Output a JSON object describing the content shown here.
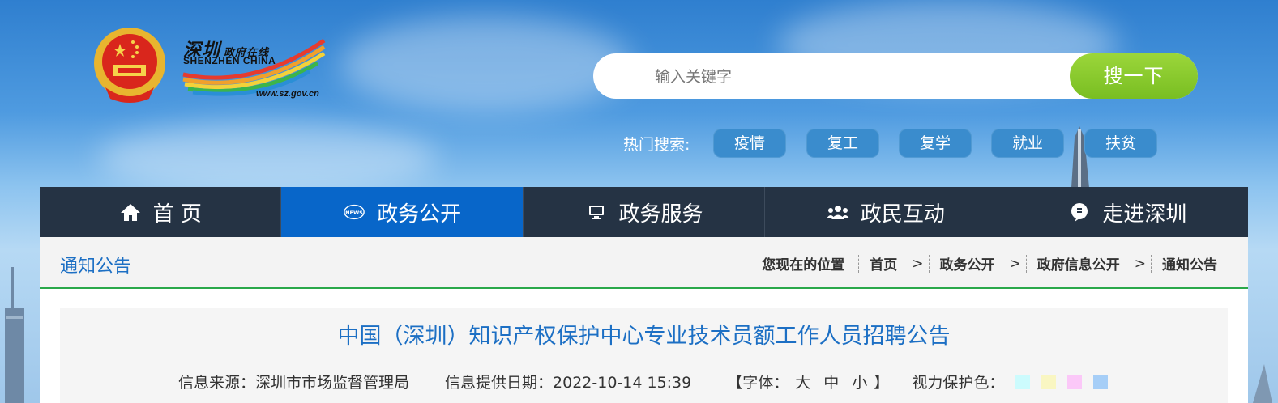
{
  "header": {
    "logo_cn": "深圳",
    "logo_cn_sub": "政府在线",
    "logo_en": "SHENZHEN CHINA",
    "logo_url": "www.sz.gov.cn"
  },
  "search": {
    "placeholder": "输入关键字",
    "value": "",
    "button_label": "搜一下"
  },
  "hot_search": {
    "label": "热门搜索:",
    "tags": [
      "疫情",
      "复工",
      "复学",
      "就业",
      "扶贫"
    ]
  },
  "nav": {
    "items": [
      {
        "label": "首 页",
        "icon": "home-icon",
        "active": false
      },
      {
        "label": "政务公开",
        "icon": "news-icon",
        "active": true
      },
      {
        "label": "政务服务",
        "icon": "monitor-icon",
        "active": false
      },
      {
        "label": "政民互动",
        "icon": "people-icon",
        "active": false
      },
      {
        "label": "走进深圳",
        "icon": "chat-icon",
        "active": false
      }
    ]
  },
  "breadcrumb": {
    "section_title": "通知公告",
    "location_label": "您现在的位置",
    "items": [
      "首页",
      "政务公开",
      "政府信息公开",
      "通知公告"
    ]
  },
  "article": {
    "title": "中国（深圳）知识产权保护中心专业技术员额工作人员招聘公告",
    "source_label": "信息来源：深圳市市场监督管理局",
    "date_label": "信息提供日期：2022-10-14 15:39",
    "font_open": "【字体：",
    "font_large": "大",
    "font_medium": "中",
    "font_small": "小",
    "font_close": "】",
    "eye_label": "视力保护色：",
    "eye_colors": [
      "#ccfbfd",
      "#f9f6c2",
      "#fbc8f8",
      "#a6cef7"
    ]
  },
  "colors": {
    "nav_bg": "#253344",
    "nav_active": "#0866c9",
    "accent_blue": "#1c6fc4",
    "search_button": "#86c92c",
    "hot_tag": "#3a8ccd",
    "divider_green": "#2aa84a"
  }
}
